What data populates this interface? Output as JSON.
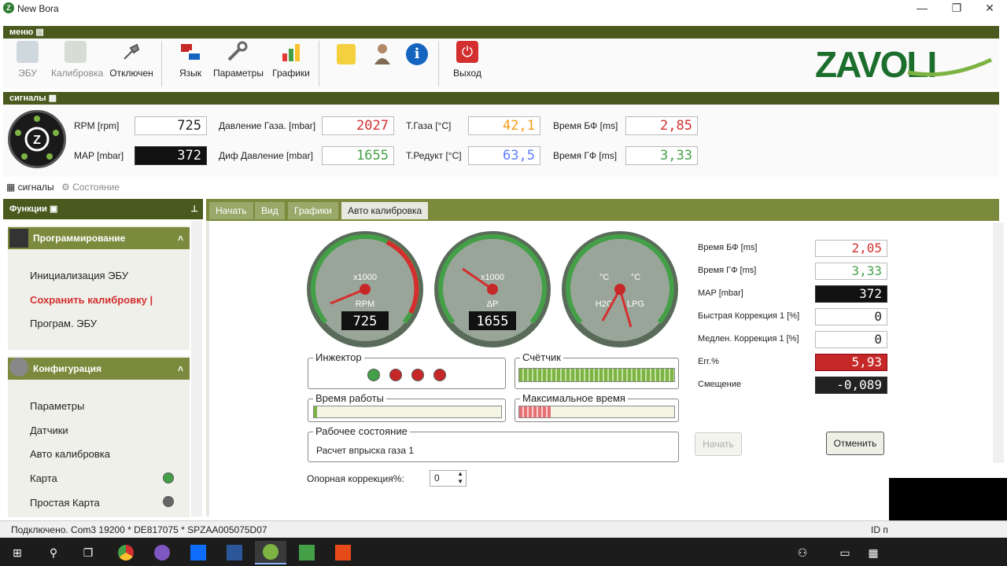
{
  "window": {
    "title": "New Bora",
    "minimize": "—",
    "maximize": "❐",
    "close": "✕"
  },
  "menu": {
    "header": "меню",
    "buttons": [
      {
        "label": "ЭБУ",
        "icon": "ecu-icon"
      },
      {
        "label": "Калибровка",
        "icon": "calibration-icon"
      },
      {
        "label": "Отключен",
        "icon": "disconnected-icon"
      },
      {
        "label": "Язык",
        "icon": "language-icon"
      },
      {
        "label": "Параметры",
        "icon": "tools-icon"
      },
      {
        "label": "Графики",
        "icon": "charts-icon"
      },
      {
        "label": "Выход",
        "icon": "power-icon"
      }
    ],
    "logo": "ZAVOLI"
  },
  "signals": {
    "header": "сигналы",
    "rpm_label": "RPM [rpm]",
    "rpm": "725",
    "map_label": "MAP [mbar]",
    "map": "372",
    "gas_pressure_label": "Давление Газа. [mbar]",
    "gas_pressure": "2027",
    "diff_pressure_label": "Диф Давление [mbar]",
    "diff_pressure": "1655",
    "gas_temp_label": "T.Газа [°C]",
    "gas_temp": "42,1",
    "reducer_temp_label": "T.Редукт [°C]",
    "reducer_temp": "63,5",
    "bf_time_label": "Время БФ [ms]",
    "bf_time": "2,85",
    "gf_time_label": "Время ГФ [ms]",
    "gf_time": "3,33",
    "tab_signals": "сигналы",
    "tab_state": "Состояние"
  },
  "functions": {
    "header": "Функции",
    "group1": "Программирование",
    "group1_items": [
      "Инициализация ЭБУ",
      "Сохранить калибровку |",
      "Програм. ЭБУ"
    ],
    "group2": "Конфигурация",
    "group2_items": [
      "Параметры",
      "Датчики",
      "Авто калибровка",
      "Карта",
      "Простая Карта"
    ]
  },
  "tabs": [
    "Начать",
    "Вид",
    "Графики",
    "Авто калибровка"
  ],
  "gauges": {
    "rpm": {
      "value": "725",
      "unit": "x1000",
      "name": "RPM",
      "needle": 0.725
    },
    "dp": {
      "value": "1655",
      "unit": "x1000",
      "name": "ΔP",
      "needle": 1.655
    },
    "temp": {
      "left": "H2O",
      "right": "LPG",
      "unit_l": "°C",
      "unit_r": "°C"
    }
  },
  "autocal": {
    "bf_label": "Время БФ [ms]",
    "bf": "2,05",
    "gf_label": "Время ГФ [ms]",
    "gf": "3,33",
    "map_label": "MAP [mbar]",
    "map": "372",
    "fast_label": "Быстрая Коррекция 1 [%]",
    "fast": "0",
    "slow_label": "Медлен. Коррекция 1 [%]",
    "slow": "0",
    "err_label": "Err.%",
    "err": "5,93",
    "offset_label": "Смещение",
    "offset": "-0,089",
    "injector_label": "Инжектор",
    "counter_label": "Счётчик",
    "worktime_label": "Время работы",
    "maxtime_label": "Максимальное время",
    "state_label": "Рабочее состояние",
    "state_text": "Расчет впрыска газа 1",
    "ref_label": "Опорная коррекция%:",
    "ref_value": "0",
    "start_btn": "Начать",
    "cancel_btn": "Отменить"
  },
  "status": {
    "text": "Подключено. Com3 19200 * DE817075 * SPZAA005075D07",
    "right": "ID п"
  },
  "colors": {
    "olive": "#4a5a1e",
    "green": "#2e7d32",
    "red": "#d32f2f"
  }
}
